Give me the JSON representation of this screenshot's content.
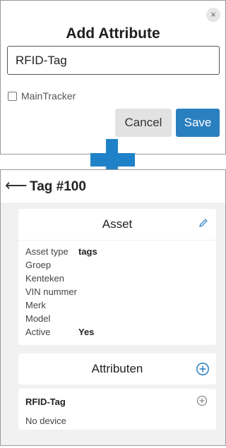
{
  "dialog": {
    "title": "Add Attribute",
    "close_symbol": "×",
    "input_value": "RFID-Tag",
    "checkbox_label": "MainTracker",
    "cancel_label": "Cancel",
    "save_label": "Save"
  },
  "screen": {
    "back_symbol": "⟵",
    "title": "Tag #100",
    "asset_card": {
      "title": "Asset",
      "properties": [
        {
          "key": "Asset type",
          "value": "tags"
        },
        {
          "key": "Groep",
          "value": ""
        },
        {
          "key": "Kenteken",
          "value": ""
        },
        {
          "key": "VIN nummer",
          "value": ""
        },
        {
          "key": "Merk",
          "value": ""
        },
        {
          "key": "Model",
          "value": ""
        },
        {
          "key": "Active",
          "value": "Yes"
        }
      ]
    },
    "attributes_card": {
      "title": "Attributen",
      "items": [
        {
          "name": "RFID-Tag",
          "status": "No device"
        }
      ]
    }
  },
  "colors": {
    "accent_blue": "#2a7fbf",
    "plus_blue": "#1f82c8",
    "background_gray": "#f1f1f1"
  },
  "icons": [
    "close-icon",
    "back-arrow-icon",
    "edit-pencil-icon",
    "add-circle-icon",
    "plus-connector-icon"
  ]
}
